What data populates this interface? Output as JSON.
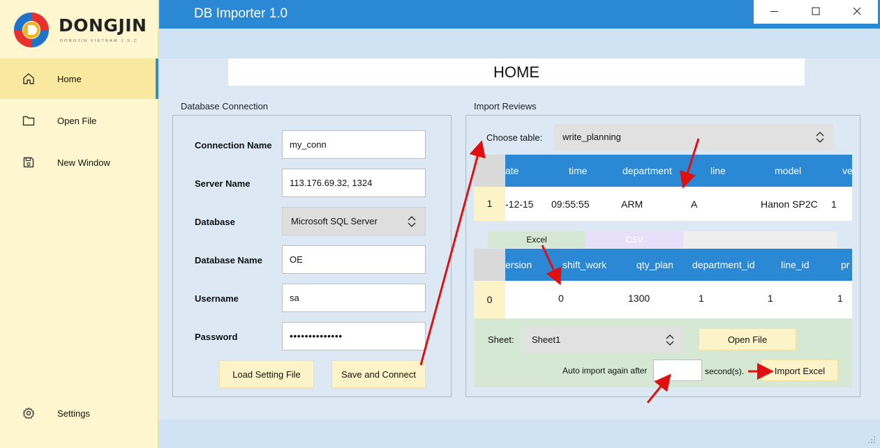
{
  "brand": {
    "name": "DONGJIN",
    "tagline": "DONGJIN VIETNAM J.S.C"
  },
  "window": {
    "title": "DB Importer 1.0"
  },
  "sidebar": {
    "items": [
      {
        "label": "Home",
        "icon": "home-icon"
      },
      {
        "label": "Open File",
        "icon": "folder-icon"
      },
      {
        "label": "New Window",
        "icon": "save-icon"
      },
      {
        "label": "Settings",
        "icon": "gear-icon"
      }
    ]
  },
  "page": {
    "title": "HOME"
  },
  "db_connection": {
    "title": "Database Connection",
    "fields": [
      {
        "label": "Connection Name",
        "value": "my_conn"
      },
      {
        "label": "Server Name",
        "value": "113.176.69.32, 1324"
      },
      {
        "label": "Database",
        "value": "Microsoft SQL Server"
      },
      {
        "label": "Database Name",
        "value": "OE"
      },
      {
        "label": "Username",
        "value": "sa"
      },
      {
        "label": "Password",
        "value": "••••••••••••••"
      }
    ],
    "load_button": "Load Setting File",
    "save_button": "Save and Connect"
  },
  "import_reviews": {
    "title": "Import Reviews",
    "choose_label": "Choose table:",
    "choose_value": "write_planning",
    "table1": {
      "headers": [
        "ate",
        "time",
        "department",
        "line",
        "model",
        "ve"
      ],
      "row_header": "1",
      "row": [
        "-12-15",
        "09:55:55",
        "ARM",
        "A",
        "Hanon SP2C",
        "1"
      ]
    },
    "tabs": [
      "Excel",
      "CSV"
    ],
    "table2": {
      "headers": [
        "ersion",
        "shift_work",
        "qty_plan",
        "department_id",
        "line_id",
        "pr"
      ],
      "row_header": "0",
      "row": [
        "0",
        "1300",
        "1",
        "1",
        "1"
      ]
    },
    "sheet_label": "Sheet:",
    "sheet_value": "Sheet1",
    "open_file_button": "Open File",
    "auto_import_label": "Auto import again after",
    "auto_import_value": "",
    "seconds_label": "second(s).",
    "import_button": "Import Excel"
  },
  "colors": {
    "accent_blue": "#2b88d4",
    "sidebar_yellow": "#fdf6cf",
    "button_yellow": "#fdf3c8",
    "annotation_red": "#e01010"
  }
}
